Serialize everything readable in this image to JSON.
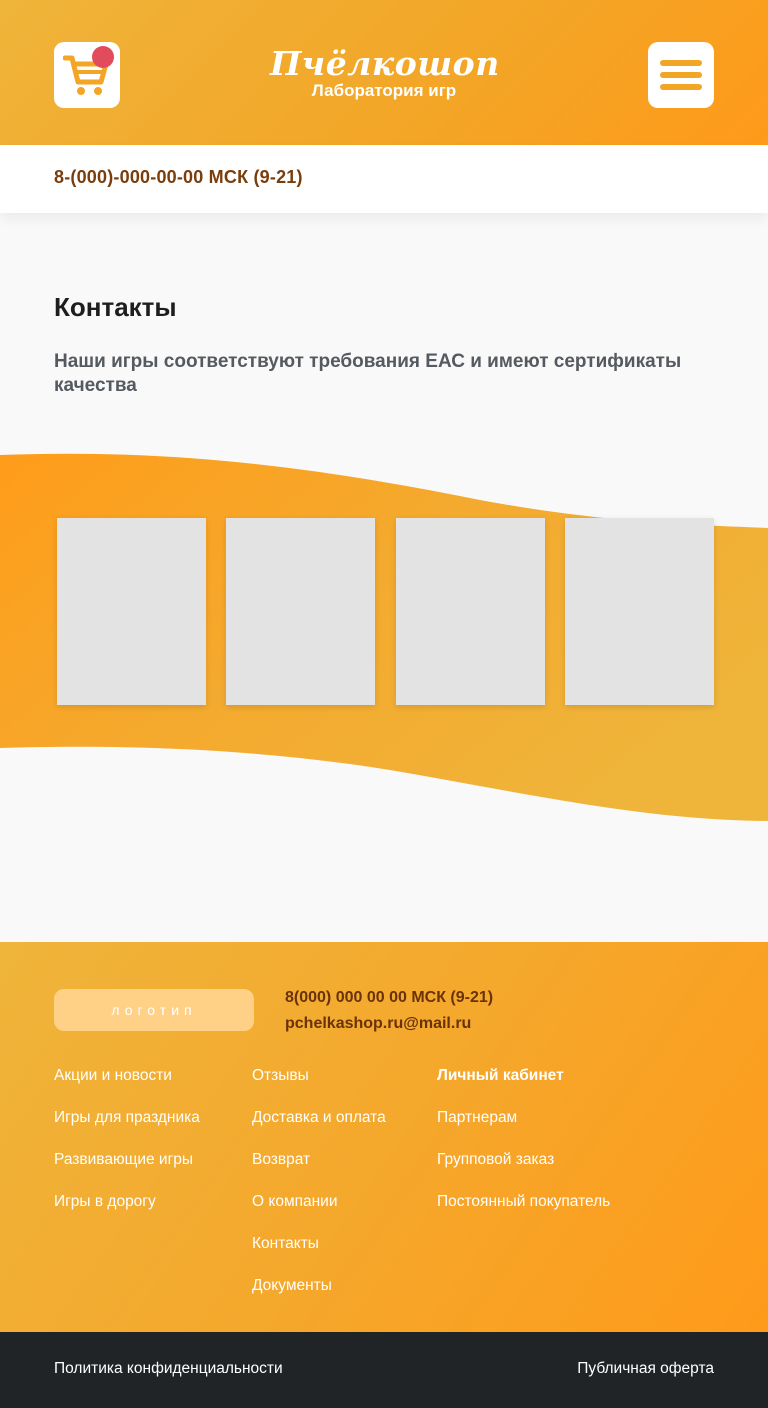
{
  "header": {
    "logo_name": "Пчёлкошоп",
    "logo_tagline": "Лаборатория игр",
    "cart_icon": "cart-icon",
    "menu_icon": "hamburger-menu-icon",
    "accent": "#f3a526",
    "badge_color": "#e14b5b"
  },
  "phone_bar": {
    "phone": "8-(000)-000-00-00 МСК (9-21)"
  },
  "main": {
    "title": "Контакты",
    "subtitle": "Наши игры соответствуют требования ЕАС и имеют сертификаты качества",
    "certificates_count": 4
  },
  "footer": {
    "logo_button": "логотип",
    "phone": "8(000) 000 00 00 МСК (9-21)",
    "email": "pchelkashop.ru@mail.ru",
    "col1": [
      "Акции и новости",
      "Игры для праздника",
      "Развивающие игры",
      "Игры в дорогу"
    ],
    "col2": [
      "Отзывы",
      "Доставка и оплата",
      "Возврат",
      "О компании",
      "Контакты",
      "Документы"
    ],
    "col3": [
      "Личный кабинет",
      "Партнерам",
      "Групповой заказ",
      "Постоянный покупатель"
    ]
  },
  "bottom_bar": {
    "privacy": "Политика конфиденциальности",
    "offer": "Публичная оферта"
  }
}
